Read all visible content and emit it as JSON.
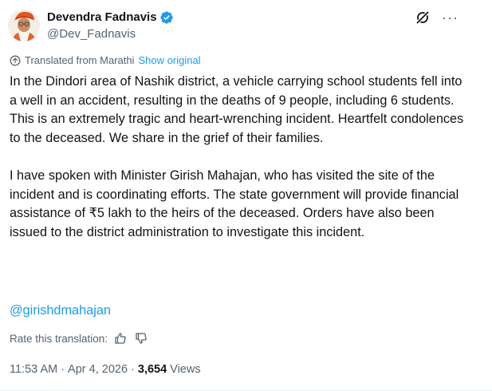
{
  "author": {
    "display_name": "Devendra Fadnavis",
    "handle": "@Dev_Fadnavis",
    "verified": true,
    "avatar_icon": "profile-avatar"
  },
  "header_actions": {
    "grok_icon": "grok-icon",
    "more_icon": "more-icon",
    "more_label": "···"
  },
  "translation": {
    "label": "Translated from Marathi",
    "show_original": "Show original"
  },
  "post": {
    "paragraph_1": "In the Dindori area of Nashik district, a vehicle carrying school students fell into a well in an accident, resulting in the deaths of 9 people, including 6 students. This is an extremely tragic and heart-wrenching incident. Heartfelt condolences to the deceased. We share in the grief of their families.",
    "paragraph_2": "I have spoken with Minister Girish Mahajan, who has visited the site of the incident and is coordinating efforts. The state government will provide financial assistance of ₹5 lakh to the heirs of the deceased. Orders have also been issued to the district administration to investigate this incident.",
    "mention": "@girishdmahajan"
  },
  "rating": {
    "label": "Rate this translation:",
    "thumbs_up_icon": "thumbs-up-icon",
    "thumbs_down_icon": "thumbs-down-icon"
  },
  "meta": {
    "time": "11:53 AM",
    "separator": "·",
    "date": "Apr 4, 2026",
    "views_count": "3,654",
    "views_label": "Views"
  },
  "colors": {
    "accent": "#1d9bf0",
    "text_primary": "#0f1419",
    "text_secondary": "#536471"
  }
}
